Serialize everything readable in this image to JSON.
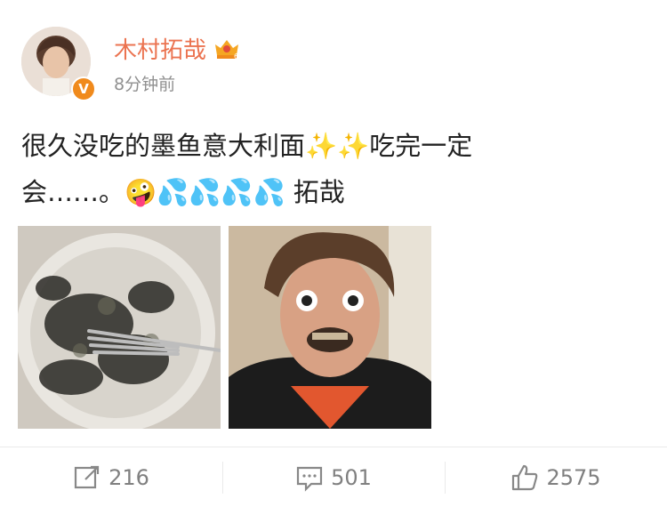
{
  "post": {
    "author": "木村拓哉",
    "time_ago": "8分钟前",
    "verified_mark": "V",
    "content": {
      "line1_text_a": "很久没吃的墨鱼意大利面",
      "sparkles": "✨✨",
      "line1_text_b": "吃完一定",
      "line2_text": "会……。",
      "emoji_face": "🤪",
      "emoji_drops": "💦💦💦💦",
      "signature": " 拓哉"
    }
  },
  "actions": {
    "repost_count": "216",
    "comment_count": "501",
    "like_count": "2575"
  }
}
